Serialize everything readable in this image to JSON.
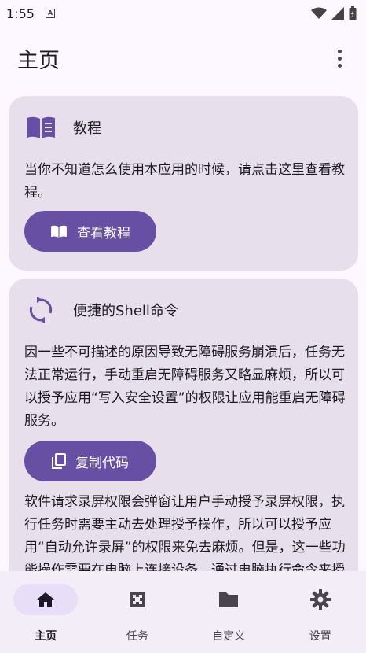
{
  "status_bar": {
    "time": "1:55",
    "notification_letter": "A"
  },
  "app_bar": {
    "title": "主页"
  },
  "cards": [
    {
      "title": "教程",
      "body": "当你不知道怎么使用本应用的时候，请点击这里查看教程。",
      "button_label": "查看教程",
      "icon": "book-icon"
    },
    {
      "title": "便捷的Shell命令",
      "body": "因一些不可描述的原因导致无障碍服务崩溃后，任务无法正常运行，手动重启无障碍服务又略显麻烦，所以可以授予应用“写入安全设置”的权限让应用能重启无障碍服务。",
      "button_label": "复制代码",
      "body2": "软件请求录屏权限会弹窗让用户手动授予录屏权限，执行任务时需要主动去处理授予操作，所以可以授予应用“自动允许录屏”的权限来免去麻烦。但是，这一些功能操作需要在电脑上连接设备，通过电脑执行命令来授权。",
      "icon": "refresh-icon"
    }
  ],
  "bottom_nav": [
    {
      "label": "主页",
      "icon": "home-icon",
      "active": true
    },
    {
      "label": "任务",
      "icon": "task-icon",
      "active": false
    },
    {
      "label": "自定义",
      "icon": "folder-icon",
      "active": false
    },
    {
      "label": "设置",
      "icon": "settings-icon",
      "active": false
    }
  ],
  "colors": {
    "primary": "#6750a4",
    "card": "#e7e0ec",
    "background": "#fdf7ff",
    "nav": "#f3edf7"
  }
}
